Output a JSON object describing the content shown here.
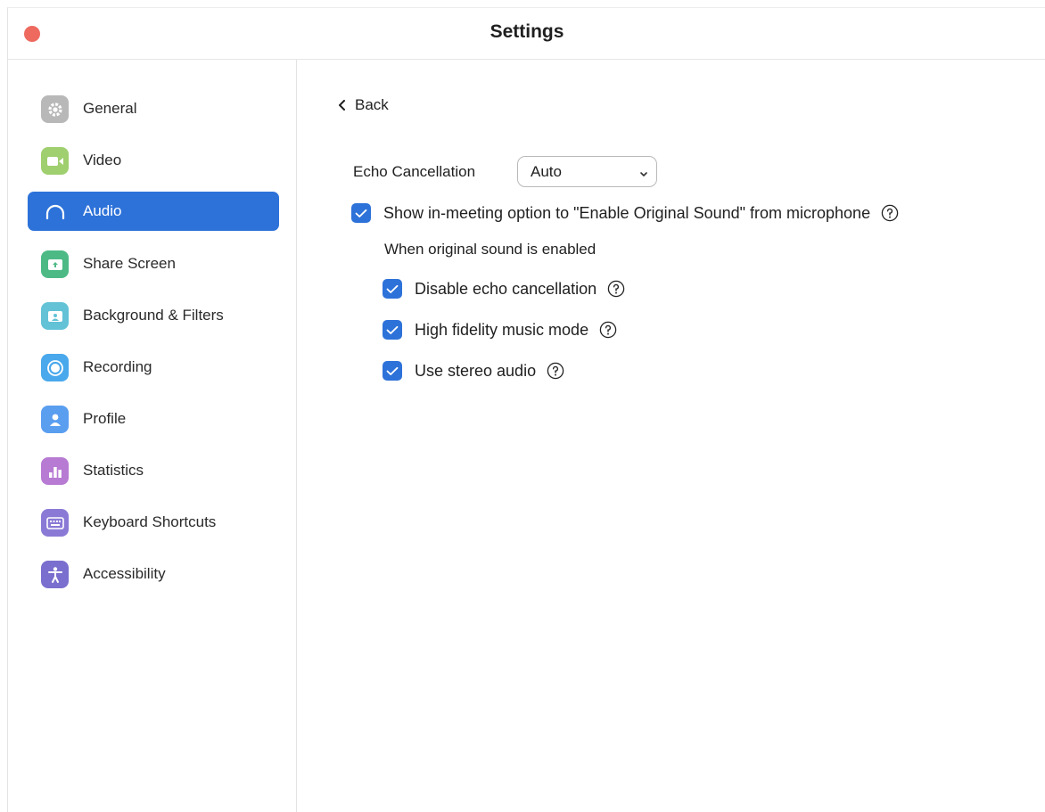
{
  "window": {
    "title": "Settings",
    "close_color": "#ee6a5f"
  },
  "sidebar": {
    "items": [
      {
        "label": "General",
        "icon": "gear-icon",
        "color": "#b8b8b8",
        "active": false
      },
      {
        "label": "Video",
        "icon": "video-camera-icon",
        "color": "#9fcf6e",
        "active": false
      },
      {
        "label": "Audio",
        "icon": "headphones-icon",
        "color": "#2d72d9",
        "active": true
      },
      {
        "label": "Share Screen",
        "icon": "share-screen-icon",
        "color": "#4dba86",
        "active": false
      },
      {
        "label": "Background & Filters",
        "icon": "background-icon",
        "color": "#63c2d6",
        "active": false
      },
      {
        "label": "Recording",
        "icon": "recording-icon",
        "color": "#4aa8ec",
        "active": false
      },
      {
        "label": "Profile",
        "icon": "profile-icon",
        "color": "#5a9ef0",
        "active": false
      },
      {
        "label": "Statistics",
        "icon": "statistics-icon",
        "color": "#b77bd3",
        "active": false
      },
      {
        "label": "Keyboard Shortcuts",
        "icon": "keyboard-icon",
        "color": "#8a7ad6",
        "active": false
      },
      {
        "label": "Accessibility",
        "icon": "accessibility-icon",
        "color": "#7a6fce",
        "active": false
      }
    ]
  },
  "content": {
    "back_label": "Back",
    "echo_cancellation": {
      "label": "Echo Cancellation",
      "selected": "Auto"
    },
    "original_sound_option": {
      "label": "Show in-meeting option to \"Enable Original Sound\" from microphone",
      "checked": true
    },
    "sub_heading": "When original sound is enabled",
    "sub_options": [
      {
        "label": "Disable echo cancellation",
        "checked": true
      },
      {
        "label": "High fidelity music mode",
        "checked": true
      },
      {
        "label": "Use stereo audio",
        "checked": true
      }
    ]
  },
  "colors": {
    "accent": "#2d72d9",
    "divider": "#e3e3e3"
  }
}
